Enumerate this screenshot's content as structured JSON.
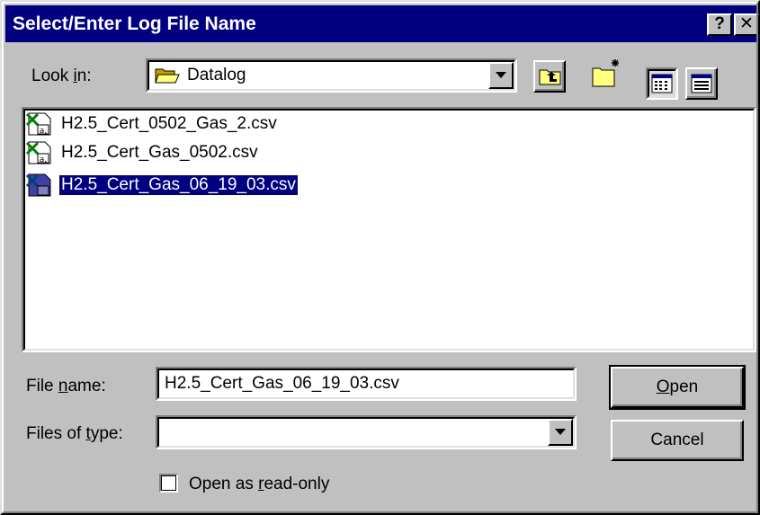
{
  "window": {
    "title": "Select/Enter Log File Name",
    "help_glyph": "?",
    "close_glyph": "✕"
  },
  "look_in": {
    "label_pre": "Look ",
    "label_key": "i",
    "label_post": "n:",
    "value": "Datalog",
    "icon": "open-folder-icon"
  },
  "toolbar": {
    "icons": [
      "up-one-level-icon",
      "create-new-folder-icon",
      "list-view-icon",
      "details-view-icon"
    ]
  },
  "files": {
    "items": [
      {
        "name": "H2.5_Cert_0502_Gas_2.csv",
        "icon": "excel-csv-file-icon",
        "selected": false
      },
      {
        "name": "H2.5_Cert_Gas_0502.csv",
        "icon": "excel-csv-file-icon",
        "selected": false
      },
      {
        "name": "H2.5_Cert_Gas_06_19_03.csv",
        "icon": "excel-csv-file-icon",
        "selected": true
      }
    ]
  },
  "file_name": {
    "label_pre": "File ",
    "label_key": "n",
    "label_post": "ame:",
    "value": "H2.5_Cert_Gas_06_19_03.csv"
  },
  "file_type": {
    "label_pre": "Files of ",
    "label_key": "t",
    "label_post": "ype:",
    "value": ""
  },
  "buttons": {
    "open_key": "O",
    "open_rest": "pen",
    "cancel": "Cancel"
  },
  "read_only": {
    "label_pre": "Open as ",
    "label_key": "r",
    "label_post": "ead-only",
    "checked": false
  },
  "colors": {
    "face": "#c0c0c0",
    "title_bar": "#000080",
    "selection": "#000080",
    "window_bg": "#ffffff"
  }
}
